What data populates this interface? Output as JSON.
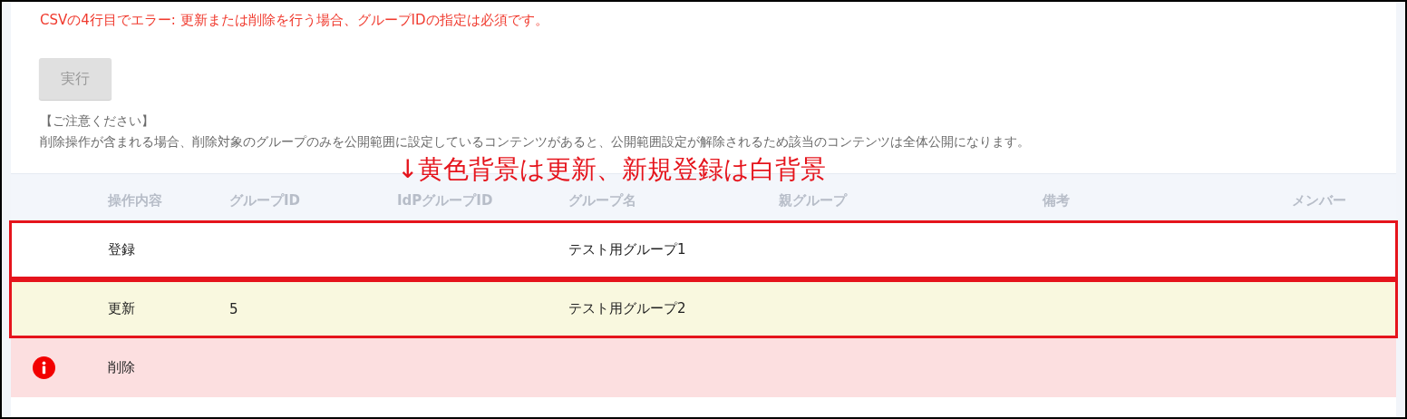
{
  "error_message": "CSVの4行目でエラー: 更新または削除を行う場合、グループIDの指定は必須です。",
  "execute_button": {
    "label": "実行",
    "disabled": true
  },
  "notice": {
    "title": "【ご注意ください】",
    "body": "削除操作が含まれる場合、削除対象のグループのみを公開範囲に設定しているコンテンツがあると、公開範囲設定が解除されるため該当のコンテンツは全体公開になります。"
  },
  "annotation": "↓黄色背景は更新、新規登録は白背景",
  "table": {
    "columns": [
      "操作内容",
      "グループID",
      "IdPグループID",
      "グループ名",
      "親グループ",
      "備考",
      "メンバー"
    ],
    "rows": [
      {
        "kind": "new",
        "annotated": true,
        "cells": [
          "登録",
          "",
          "",
          "テスト用グループ1",
          "",
          "",
          ""
        ]
      },
      {
        "kind": "update",
        "annotated": true,
        "cells": [
          "更新",
          "5",
          "",
          "テスト用グループ2",
          "",
          "",
          ""
        ]
      },
      {
        "kind": "error",
        "annotated": false,
        "cells": [
          "削除",
          "",
          "",
          "",
          "",
          "",
          ""
        ]
      }
    ]
  }
}
